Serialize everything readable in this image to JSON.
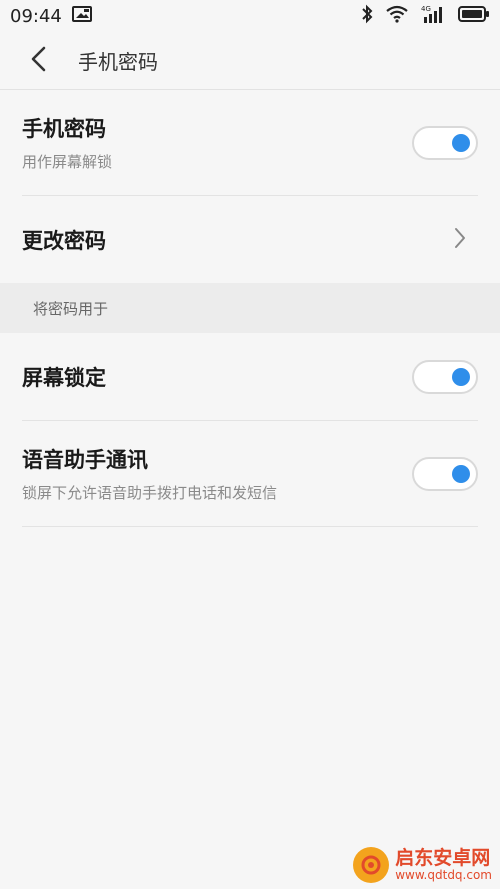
{
  "status_bar": {
    "time": "09:44",
    "icons": [
      "image-notification-icon",
      "bluetooth-icon",
      "wifi-icon",
      "signal-4g-icon",
      "battery-icon"
    ],
    "network_label": "4G"
  },
  "header": {
    "back_icon": "chevron-left-icon",
    "title": "手机密码"
  },
  "settings": {
    "phone_password": {
      "label": "手机密码",
      "description": "用作屏幕解锁",
      "enabled": true
    },
    "change_password": {
      "label": "更改密码",
      "icon": "chevron-right-icon"
    }
  },
  "use_password_for": {
    "header": "将密码用于",
    "items": [
      {
        "label": "屏幕锁定",
        "description": "",
        "enabled": true
      },
      {
        "label": "语音助手通讯",
        "description": "锁屏下允许语音助手拨打电话和发短信",
        "enabled": true
      }
    ]
  },
  "watermark": {
    "main": "启东安卓网",
    "sub": "www.qdtdq.com"
  },
  "colors": {
    "toggle_on": "#2f8eea",
    "background": "#f6f6f6",
    "group_header_bg": "#ececec"
  }
}
